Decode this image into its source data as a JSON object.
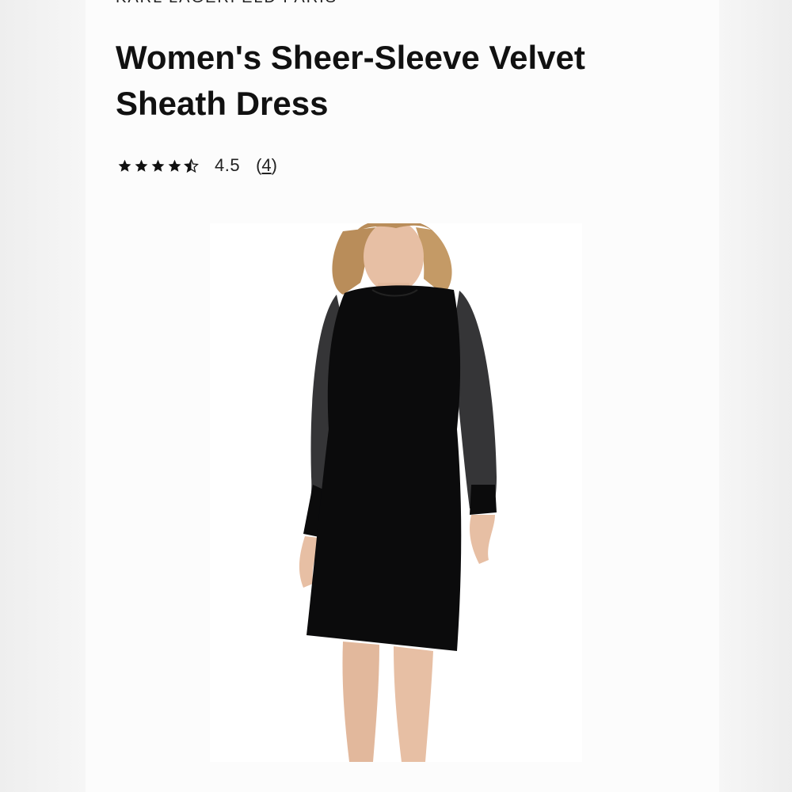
{
  "product": {
    "brand": "KARL LAGERFELD PARIS",
    "title": "Women's Sheer-Sleeve Velvet Sheath Dress",
    "rating": {
      "stars": 4.5,
      "score_text": "4.5",
      "count_open": "(",
      "count": "4",
      "count_close": ")"
    },
    "image_alt_icon": "dress-photo"
  },
  "colors": {
    "text": "#111111",
    "dress": "#0b0b0c",
    "skin": "#e7bfa4",
    "hair": "#b98d5a"
  }
}
